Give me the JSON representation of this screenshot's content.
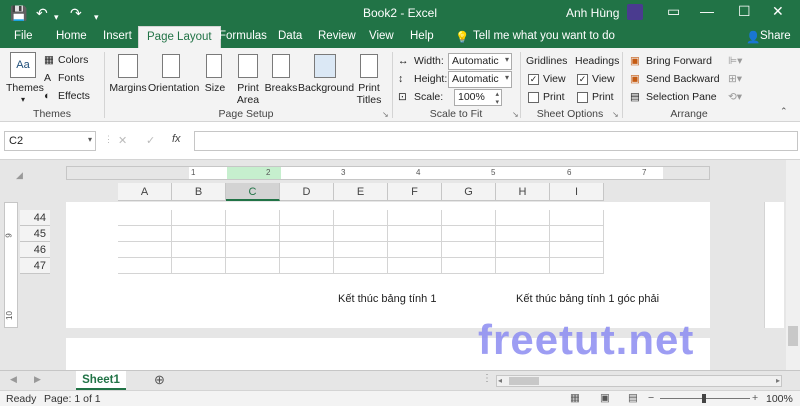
{
  "titlebar": {
    "title": "Book2  -  Excel",
    "user": "Anh Hùng",
    "save_icon": "save-icon",
    "undo_icon": "undo-icon",
    "redo_icon": "redo-icon"
  },
  "tabs": [
    "File",
    "Home",
    "Insert",
    "Page Layout",
    "Formulas",
    "Data",
    "Review",
    "View",
    "Help"
  ],
  "tell_me": "Tell me what you want to do",
  "share": "Share",
  "ribbon": {
    "themes": {
      "themes": "Themes",
      "colors": "Colors",
      "fonts": "Fonts",
      "effects": "Effects",
      "group": "Themes"
    },
    "page_setup": {
      "margins": "Margins",
      "orientation": "Orientation",
      "size": "Size",
      "print_area": "Print\nArea",
      "breaks": "Breaks",
      "background": "Background",
      "print_titles": "Print\nTitles",
      "group": "Page Setup"
    },
    "scale_to_fit": {
      "width_label": "Width:",
      "width_value": "Automatic",
      "height_label": "Height:",
      "height_value": "Automatic",
      "scale_label": "Scale:",
      "scale_value": "100%",
      "group": "Scale to Fit"
    },
    "sheet_options": {
      "gridlines": "Gridlines",
      "headings": "Headings",
      "view": "View",
      "print": "Print",
      "group": "Sheet Options"
    },
    "arrange": {
      "bring_forward": "Bring Forward",
      "send_backward": "Send Backward",
      "selection_pane": "Selection Pane",
      "group": "Arrange"
    }
  },
  "formula_bar": {
    "name_box": "C2",
    "fx": "fx",
    "cancel": "✕",
    "enter": "✓"
  },
  "columns": [
    "A",
    "B",
    "C",
    "D",
    "E",
    "F",
    "G",
    "H",
    "I"
  ],
  "selected_column": "C",
  "ruler_labels": [
    "1",
    "2",
    "3",
    "4",
    "5",
    "6",
    "7"
  ],
  "side_ruler_labels": [
    "9",
    "10"
  ],
  "rows": [
    "44",
    "45",
    "46",
    "47"
  ],
  "footer": {
    "center": "Kết thúc bảng tính 1",
    "right": "Kết thúc bảng tính 1 góc phải"
  },
  "sheet_tab": "Sheet1",
  "status": {
    "ready": "Ready",
    "page": "Page: 1 of 1",
    "zoom": "100%"
  },
  "watermark": "freetut.net",
  "colors": {
    "accent": "#217346"
  }
}
